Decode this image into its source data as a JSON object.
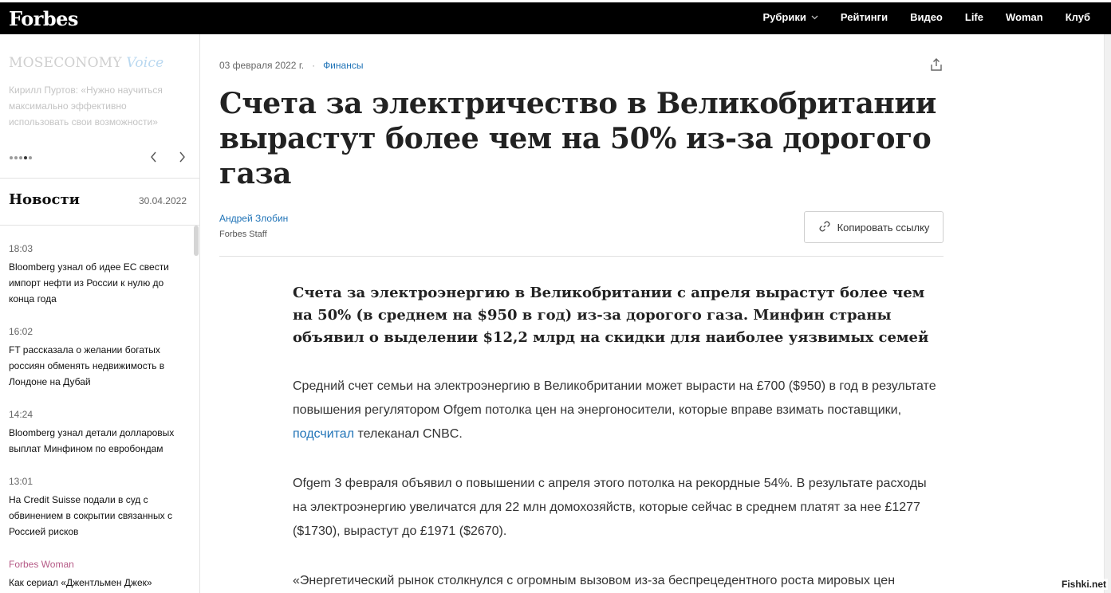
{
  "header": {
    "logo": "Forbes",
    "nav": [
      {
        "label": "Рубрики",
        "has_dropdown": true
      },
      {
        "label": "Рейтинги"
      },
      {
        "label": "Видео"
      },
      {
        "label": "Life"
      },
      {
        "label": "Woman"
      },
      {
        "label": "Клуб"
      }
    ]
  },
  "sidebar": {
    "promo_brand": "MOSECONOMY",
    "promo_voice": "Voice",
    "promo_text": "Кирилл Пуртов: «Нужно научиться максимально эффективно использовать свои возможности»",
    "news_heading": "Новости",
    "news_date": "30.04.2022",
    "news": [
      {
        "time": "18:03",
        "text": "Bloomberg узнал об идее ЕС свести импорт нефти из России к нулю до конца года"
      },
      {
        "time": "16:02",
        "text": "FT рассказала о желании богатых россиян обменять недвижимость в Лондоне на Дубай"
      },
      {
        "time": "14:24",
        "text": "Bloomberg узнал детали долларовых выплат Минфином по евробондам"
      },
      {
        "time": "13:01",
        "text": "На Credit Suisse подали в суд с обвинением в сокрытии связанных с Россией рисков"
      },
      {
        "time": "Forbes Woman",
        "text": "Как сериал «Джентльмен Джек»"
      }
    ]
  },
  "article": {
    "date": "03 февраля 2022 г.",
    "category": "Финансы",
    "title": "Счета за электричество в Великобритании вырастут более чем на 50% из-за дорогого газа",
    "author": "Андрей Злобин",
    "author_role": "Forbes Staff",
    "copy_link_label": "Копировать ссылку",
    "lead": "Счета за электроэнергию в Великобритании с апреля вырастут более чем на 50% (в среднем на $950 в год) из-за дорогого газа. Минфин страны объявил о выделении $12,2 млрд на скидки для наиболее уязвимых семей",
    "p1_before": "Средний счет семьи на электроэнергию в Великобритании может вырасти на £700 ($950) в год в результате повышения регулятором Ofgem потолка цен на энергоносители, которые вправе взимать поставщики, ",
    "p1_link": "подсчитал",
    "p1_after": " телеканал CNBC.",
    "p2": "Ofgem 3 февраля объявил о повышении с апреля этого потолка на рекордные 54%. В результате расходы на электроэнергию увеличатся для 22 млн домохозяйств, которые сейчас в среднем платят за нее £1277 ($1730), вырастут до £1971 ($2670).",
    "p3": "«Энергетический рынок столкнулся с огромным вызовом из-за беспрецедентного роста мировых цен"
  },
  "watermark": "Fishki.net"
}
